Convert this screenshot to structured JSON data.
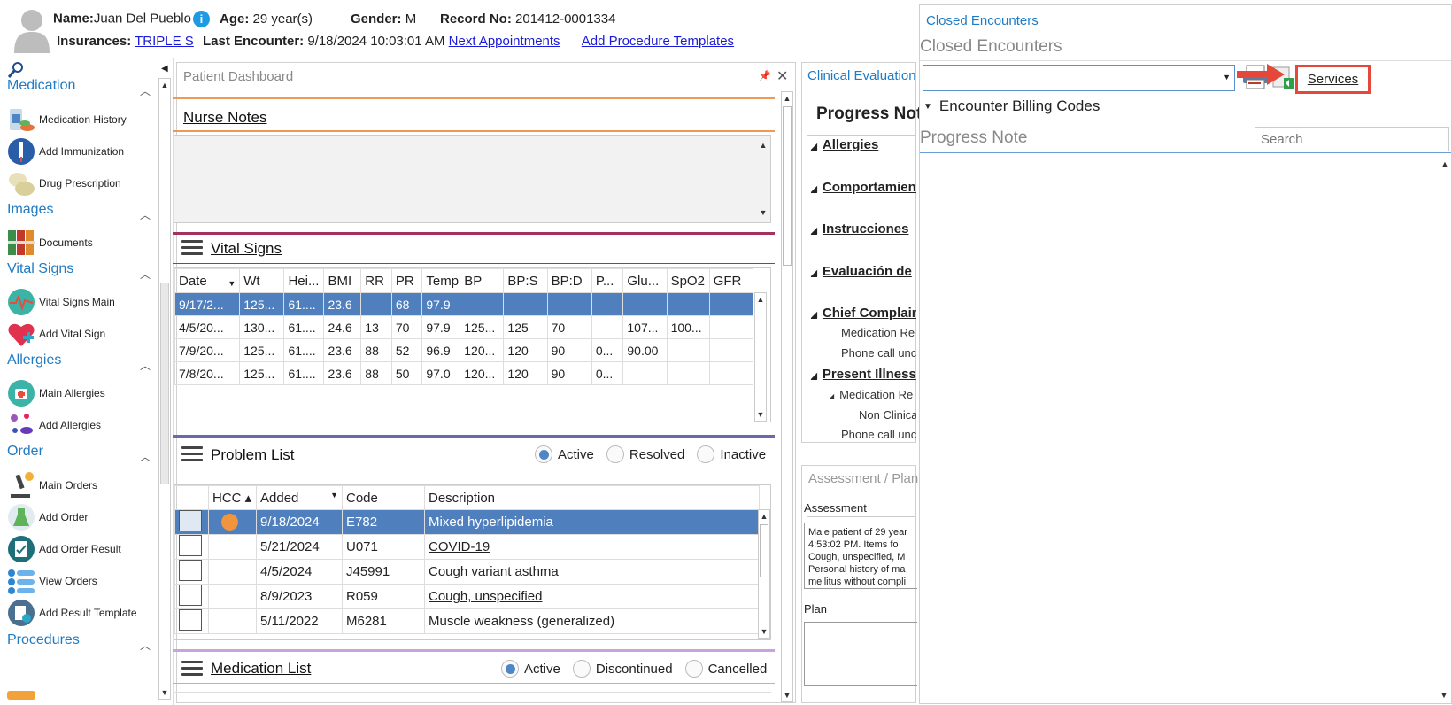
{
  "patient": {
    "name_label": "Name:",
    "name": "Juan Del Pueblo",
    "age_label": "Age:",
    "age": "29 year(s)",
    "gender_label": "Gender:",
    "gender": "M",
    "record_label": "Record No:",
    "record": "201412-0001334",
    "insurances_label": "Insurances:",
    "insurance": "TRIPLE S",
    "last_enc_label": "Last Encounter:",
    "last_enc": "9/18/2024 10:03:01 AM",
    "next_appointments": "Next Appointments",
    "add_procedure_templates": "Add Procedure Templates"
  },
  "sidebar": {
    "sections": [
      {
        "title": "Medication",
        "items": [
          "Medication History",
          "Add Immunization",
          "Drug Prescription"
        ]
      },
      {
        "title": "Images",
        "items": [
          "Documents"
        ]
      },
      {
        "title": "Vital Signs",
        "items": [
          "Vital Signs Main",
          "Add Vital Sign"
        ]
      },
      {
        "title": "Allergies",
        "items": [
          "Main Allergies",
          "Add Allergies"
        ]
      },
      {
        "title": "Order",
        "items": [
          "Main Orders",
          "Add Order",
          "Add Order Result",
          "View Orders",
          "Add Result Template"
        ]
      },
      {
        "title": "Procedures",
        "items": []
      }
    ]
  },
  "dashboard": {
    "title": "Patient Dashboard",
    "nurse_notes": "Nurse Notes",
    "vital_signs": {
      "title": "Vital Signs",
      "headers": [
        "Date",
        "Wt",
        "Hei...",
        "BMI",
        "RR",
        "PR",
        "Temp",
        "BP",
        "BP:S",
        "BP:D",
        "P...",
        "Glu...",
        "SpO2",
        "GFR"
      ],
      "rows": [
        [
          "9/17/2...",
          "125...",
          "61....",
          "23.6",
          "",
          "68",
          "97.9",
          "",
          "",
          "",
          "",
          "",
          "",
          ""
        ],
        [
          "4/5/20...",
          "130...",
          "61....",
          "24.6",
          "13",
          "70",
          "97.9",
          "125...",
          "125",
          "70",
          "",
          "107...",
          "100...",
          ""
        ],
        [
          "7/9/20...",
          "125...",
          "61....",
          "23.6",
          "88",
          "52",
          "96.9",
          "120...",
          "120",
          "90",
          "0...",
          "90.00",
          "",
          ""
        ],
        [
          "7/8/20...",
          "125...",
          "61....",
          "23.6",
          "88",
          "50",
          "97.0",
          "120...",
          "120",
          "90",
          "0...",
          "",
          "",
          ""
        ]
      ]
    },
    "problem_list": {
      "title": "Problem List",
      "filters": [
        "Active",
        "Resolved",
        "Inactive"
      ],
      "headers": [
        "HCC",
        "Added",
        "Code",
        "Description"
      ],
      "rows": [
        {
          "added": "9/18/2024",
          "code": "E782",
          "desc": "Mixed hyperlipidemia"
        },
        {
          "added": "5/21/2024",
          "code": "U071",
          "desc": "COVID-19"
        },
        {
          "added": "4/5/2024",
          "code": "J45991",
          "desc": "Cough variant asthma"
        },
        {
          "added": "8/9/2023",
          "code": "R059",
          "desc": "Cough, unspecified"
        },
        {
          "added": "5/11/2022",
          "code": "M6281",
          "desc": "Muscle weakness (generalized)"
        }
      ]
    },
    "medication_list": {
      "title": "Medication List",
      "filters": [
        "Active",
        "Discontinued",
        "Cancelled"
      ]
    }
  },
  "clinical": {
    "tab": "Clinical Evaluation",
    "progress_note": "Progress Note",
    "tree": [
      "Allergies",
      "Comportamiento",
      "Instrucciones",
      "Evaluación de",
      "Chief Complaint",
      "Medication Re",
      "Phone call unc",
      "Present Illness",
      "Medication Re",
      "Non Clinica",
      "Phone call unc"
    ],
    "assessment_plan": "Assessment / Plan",
    "assessment_label": "Assessment",
    "assessment_text": [
      "Male patient of 29 year",
      "4:53:02 PM.    Items fo",
      "Cough, unspecified, M",
      "Personal history of ma",
      "mellitus without compli"
    ],
    "plan_label": "Plan"
  },
  "closed_encounters": {
    "tab": "Closed Encounters",
    "title": "Closed Encounters",
    "services": "Services",
    "billing_codes": "Encounter Billing Codes",
    "progress_note": "Progress Note",
    "search_placeholder": "Search"
  },
  "colors": {
    "accent": "#1f7bc4",
    "selected_row": "#4f7fbd",
    "highlight": "#e5483b"
  }
}
